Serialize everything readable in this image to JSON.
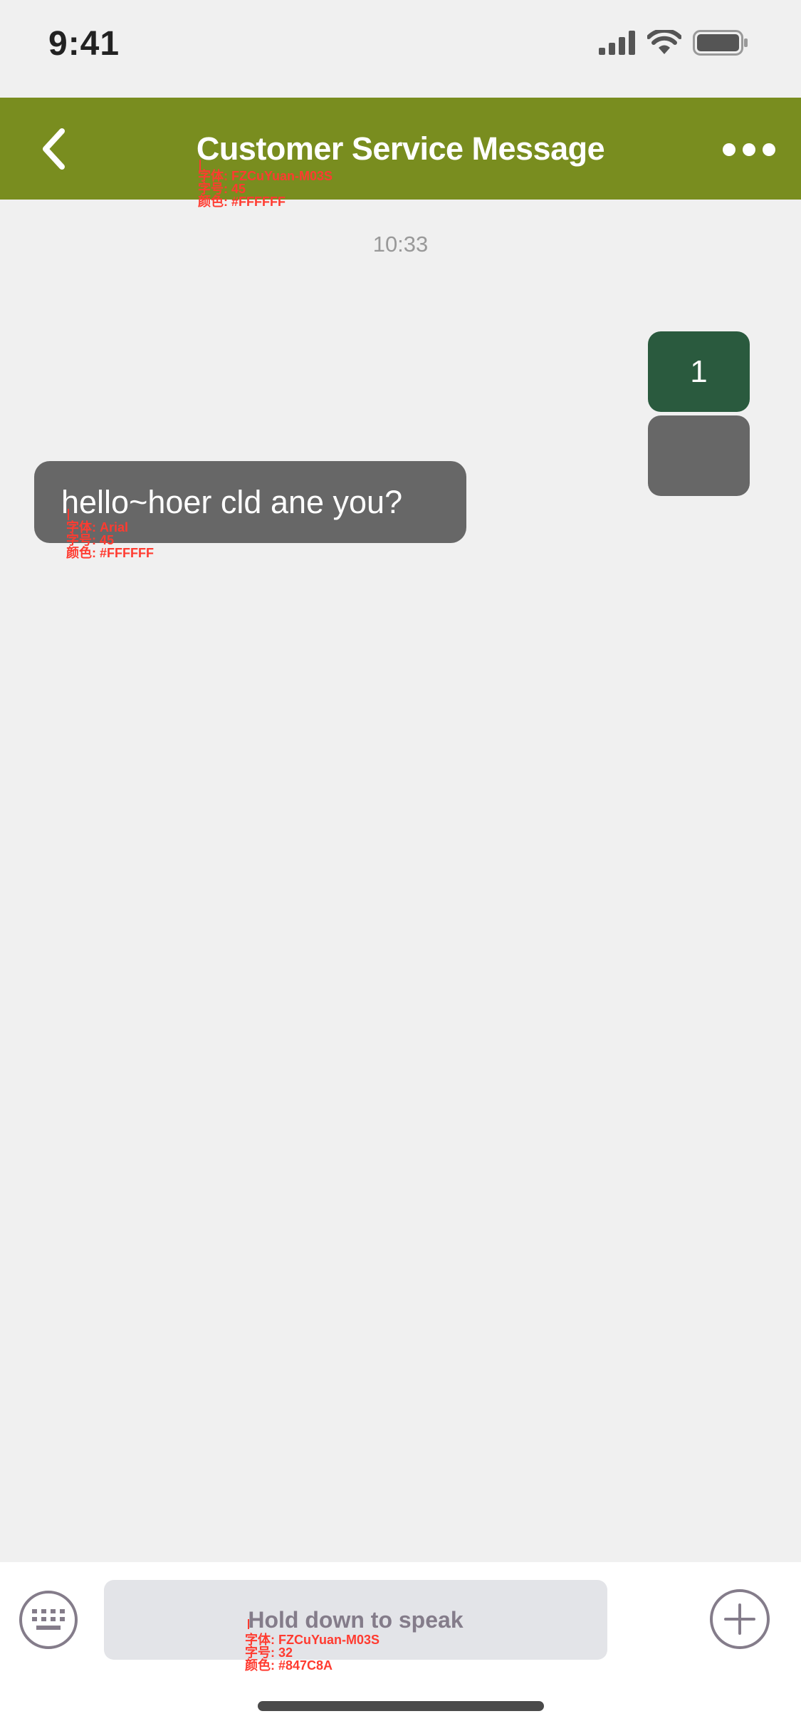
{
  "status_bar": {
    "time": "9:41"
  },
  "nav": {
    "title": "Customer Service Message",
    "back_icon": "chevron-left-icon",
    "more_icon": "more-dots-icon",
    "background": "#798d1f",
    "title_annotation": "字体: FZCuYuan-M03S\n字号: 45\n颜色: #FFFFFF"
  },
  "chat": {
    "timestamp": "10:33",
    "outgoing_message": "1",
    "incoming_message": "hello~hoer cld ane you?",
    "incoming_annotation": "字体: Arial\n字号: 45\n颜色: #FFFFFF",
    "outgoing_color": "#2a5a3e",
    "bubble_color": "#676767"
  },
  "input_bar": {
    "speak_label": "Hold down to speak",
    "speak_annotation": "字体: FZCuYuan-M03S\n字号: 32\n颜色: #847C8A",
    "keyboard_icon": "keyboard-icon",
    "plus_icon": "plus-circle-icon"
  }
}
